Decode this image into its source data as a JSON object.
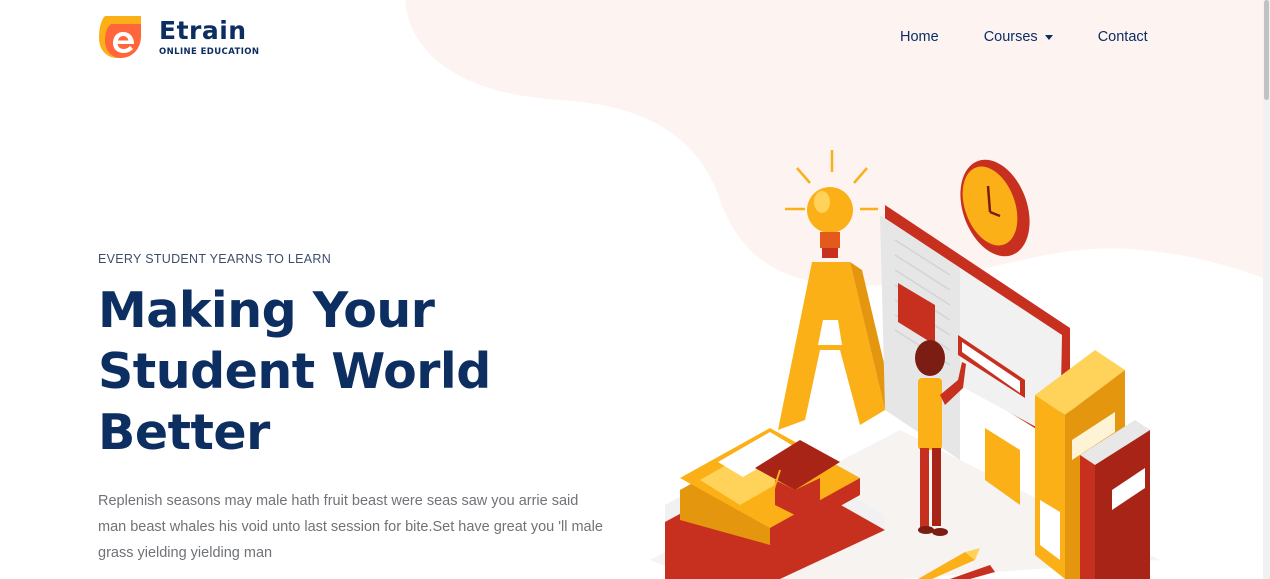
{
  "brand": {
    "name": "Etrain",
    "tagline": "ONLINE EDUCATION",
    "colors": {
      "primary": "#0c2e60",
      "accent": "#ff663b",
      "yellow": "#fbb017",
      "blob": "#fdf4f2"
    }
  },
  "nav": {
    "home": "Home",
    "courses": "Courses",
    "contact": "Contact"
  },
  "hero": {
    "eyebrow": "EVERY STUDENT YEARNS TO LEARN",
    "headline_line1": "Making Your",
    "headline_line2": "Student World",
    "headline_line3": "Better",
    "description": "Replenish seasons may male hath fruit beast were seas saw you arrie said man beast whales his void unto last session for bite.Set have great you 'll male grass yielding yielding man"
  },
  "illustration": {
    "subject": "isometric education scene: lightbulb, letter A, books, graduation cap, clock, open notebook, student, pencil"
  }
}
